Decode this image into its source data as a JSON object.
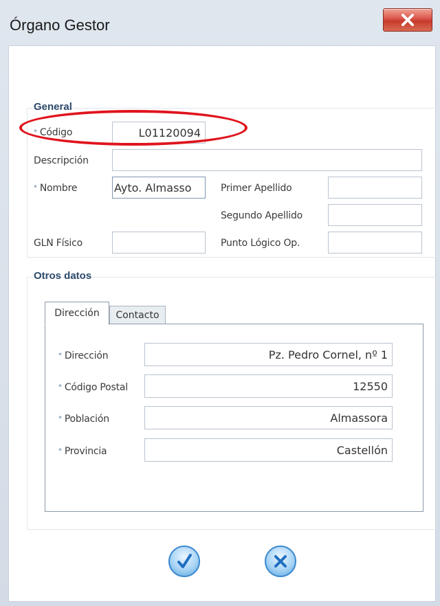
{
  "window": {
    "title": "Órgano Gestor",
    "close_label": "X"
  },
  "general": {
    "legend": "General",
    "codigo": {
      "label": "Código",
      "value": "L01120094"
    },
    "descripcion": {
      "label": "Descripción",
      "value": ""
    },
    "nombre": {
      "label": "Nombre",
      "value": "Ayto. Almasso"
    },
    "primer_apellido": {
      "label": "Primer Apellido",
      "value": ""
    },
    "segundo_apellido": {
      "label": "Segundo Apellido",
      "value": ""
    },
    "gln_fisico": {
      "label": "GLN Físico",
      "value": ""
    },
    "punto_logico": {
      "label": "Punto Lógico Op.",
      "value": ""
    },
    "required_marker": "*"
  },
  "otros": {
    "legend": "Otros datos",
    "tabs": [
      {
        "label": "Dirección",
        "active": true
      },
      {
        "label": "Contacto",
        "active": false
      }
    ],
    "direccion": {
      "label": "Dirección",
      "value": "Pz. Pedro Cornel, nº 1"
    },
    "codigo_postal": {
      "label": "Código Postal",
      "value": "12550"
    },
    "poblacion": {
      "label": "Población",
      "value": "Almassora"
    },
    "provincia": {
      "label": "Provincia",
      "value": "Castellón"
    }
  },
  "buttons": {
    "accept_icon": "checkmark-icon",
    "cancel_icon": "x-icon"
  },
  "colors": {
    "highlight": "#e0141d",
    "close_button": "#c73a2c",
    "legend_text": "#2e4a6b",
    "button_blue": "#3c8ad0"
  }
}
